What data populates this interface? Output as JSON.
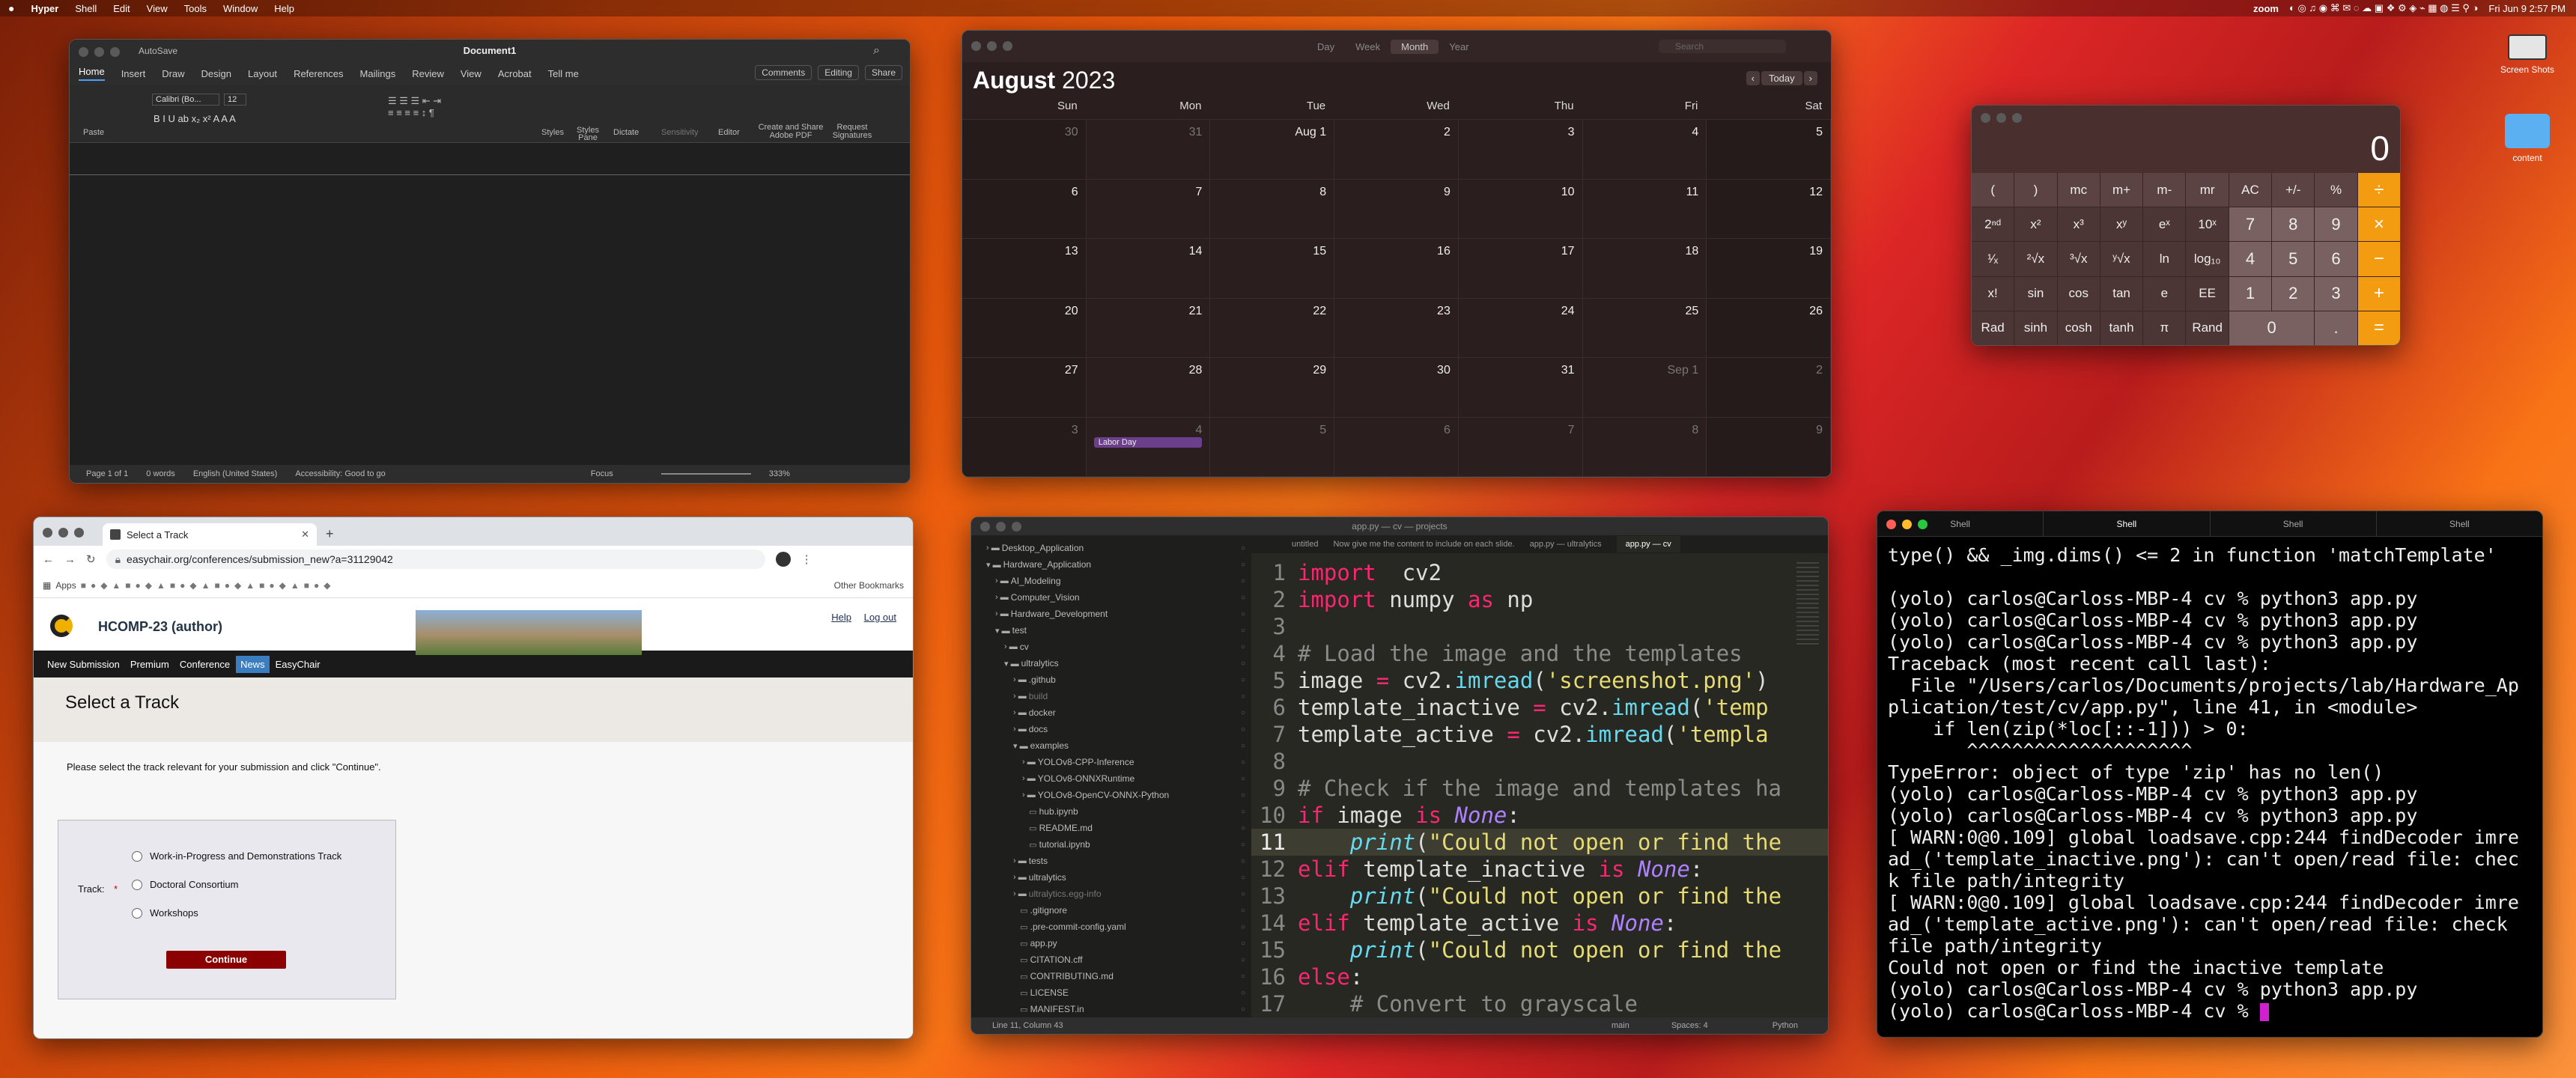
{
  "menubar": {
    "app_name": "Hyper",
    "items": [
      "Shell",
      "Edit",
      "View",
      "Tools",
      "Window",
      "Help"
    ],
    "right_app": "zoom",
    "clock": "Fri Jun 9  2:57 PM"
  },
  "desktop_icons": [
    {
      "label": "Screen Shots"
    },
    {
      "label": "content"
    }
  ],
  "word": {
    "title": "Document1",
    "autosave": "AutoSave",
    "tabs": [
      "Home",
      "Insert",
      "Draw",
      "Design",
      "Layout",
      "References",
      "Mailings",
      "Review",
      "View",
      "Acrobat",
      "Tell me"
    ],
    "comments_label": "Comments",
    "editing_label": "Editing",
    "share_label": "Share",
    "font_name": "Calibri (Bo...",
    "font_size": "12",
    "ribbon_groups": [
      "Paste",
      "Styles",
      "Styles Pane",
      "Dictate",
      "Sensitivity",
      "Editor",
      "Create and Share Adobe PDF",
      "Request Signatures"
    ],
    "status": {
      "page": "Page 1 of 1",
      "words": "0 words",
      "language": "English (United States)",
      "accessibility": "Accessibility: Good to go",
      "focus": "Focus",
      "zoom": "333%"
    }
  },
  "calendar": {
    "views": [
      "Day",
      "Week",
      "Month",
      "Year"
    ],
    "active_view": "Month",
    "search_placeholder": "Search",
    "month": "August",
    "year": "2023",
    "today_label": "Today",
    "weekdays": [
      "Sun",
      "Mon",
      "Tue",
      "Wed",
      "Thu",
      "Fri",
      "Sat"
    ],
    "weeks": [
      [
        {
          "d": "30",
          "dim": true
        },
        {
          "d": "31",
          "dim": true
        },
        {
          "d": "Aug 1"
        },
        {
          "d": "2"
        },
        {
          "d": "3"
        },
        {
          "d": "4"
        },
        {
          "d": "5"
        }
      ],
      [
        {
          "d": "6"
        },
        {
          "d": "7"
        },
        {
          "d": "8"
        },
        {
          "d": "9"
        },
        {
          "d": "10"
        },
        {
          "d": "11"
        },
        {
          "d": "12"
        }
      ],
      [
        {
          "d": "13"
        },
        {
          "d": "14"
        },
        {
          "d": "15"
        },
        {
          "d": "16"
        },
        {
          "d": "17"
        },
        {
          "d": "18"
        },
        {
          "d": "19"
        }
      ],
      [
        {
          "d": "20"
        },
        {
          "d": "21"
        },
        {
          "d": "22"
        },
        {
          "d": "23"
        },
        {
          "d": "24"
        },
        {
          "d": "25"
        },
        {
          "d": "26"
        }
      ],
      [
        {
          "d": "27"
        },
        {
          "d": "28"
        },
        {
          "d": "29"
        },
        {
          "d": "30"
        },
        {
          "d": "31"
        },
        {
          "d": "Sep 1",
          "dim": true
        },
        {
          "d": "2",
          "dim": true
        }
      ],
      [
        {
          "d": "3",
          "dim": true
        },
        {
          "d": "4",
          "dim": true
        },
        {
          "d": "5",
          "dim": true
        },
        {
          "d": "6",
          "dim": true
        },
        {
          "d": "7",
          "dim": true
        },
        {
          "d": "8",
          "dim": true
        },
        {
          "d": "9",
          "dim": true
        }
      ]
    ],
    "event": "Labor Day"
  },
  "calculator": {
    "display": "0",
    "keys": [
      [
        "(",
        ")",
        "mc",
        "m+",
        "m-",
        "mr",
        "AC",
        "+/-",
        "%",
        "÷"
      ],
      [
        "2ⁿᵈ",
        "x²",
        "x³",
        "xʸ",
        "eˣ",
        "10ˣ",
        "7",
        "8",
        "9",
        "×"
      ],
      [
        "¹⁄ₓ",
        "²√x",
        "³√x",
        "ʸ√x",
        "ln",
        "log₁₀",
        "4",
        "5",
        "6",
        "−"
      ],
      [
        "x!",
        "sin",
        "cos",
        "tan",
        "e",
        "EE",
        "1",
        "2",
        "3",
        "+"
      ],
      [
        "Rad",
        "sinh",
        "cosh",
        "tanh",
        "π",
        "Rand",
        "0",
        "",
        ".",
        "="
      ]
    ]
  },
  "browser": {
    "tab_title": "Select a Track",
    "url": "easychair.org/conferences/submission_new?a=31129042",
    "bookmarks_apps": "Apps",
    "other_bookmarks": "Other Bookmarks",
    "site_title": "HCOMP-23 (author)",
    "help_link": "Help",
    "logout_link": "Log out",
    "nav": [
      "New Submission",
      "Premium",
      "Conference",
      "News",
      "EasyChair"
    ],
    "page_heading": "Select a Track",
    "instruction": "Please select the track relevant for your submission and click \"Continue\".",
    "track_label": "Track:",
    "tracks": [
      "Work-in-Progress and Demonstrations Track",
      "Doctoral Consortium",
      "Workshops"
    ],
    "continue_label": "Continue"
  },
  "editor": {
    "title": "app.py — cv — projects",
    "tabs": [
      "untitled",
      "Now give me the content to include on each slide.",
      "app.py — ultralytics",
      "app.py — cv"
    ],
    "tree": [
      {
        "name": "Desktop_Application",
        "depth": 1,
        "type": "folder"
      },
      {
        "name": "Hardware_Application",
        "depth": 1,
        "type": "folder-open"
      },
      {
        "name": "AI_Modeling",
        "depth": 2,
        "type": "folder"
      },
      {
        "name": "Computer_Vision",
        "depth": 2,
        "type": "folder"
      },
      {
        "name": "Hardware_Development",
        "depth": 2,
        "type": "folder"
      },
      {
        "name": "test",
        "depth": 2,
        "type": "folder-open"
      },
      {
        "name": "cv",
        "depth": 3,
        "type": "folder"
      },
      {
        "name": "ultralytics",
        "depth": 3,
        "type": "folder-open"
      },
      {
        "name": ".github",
        "depth": 4,
        "type": "folder"
      },
      {
        "name": "build",
        "depth": 4,
        "type": "folder",
        "dim": true
      },
      {
        "name": "docker",
        "depth": 4,
        "type": "folder"
      },
      {
        "name": "docs",
        "depth": 4,
        "type": "folder"
      },
      {
        "name": "examples",
        "depth": 4,
        "type": "folder-open"
      },
      {
        "name": "YOLOv8-CPP-Inference",
        "depth": 5,
        "type": "folder"
      },
      {
        "name": "YOLOv8-ONNXRuntime",
        "depth": 5,
        "type": "folder"
      },
      {
        "name": "YOLOv8-OpenCV-ONNX-Python",
        "depth": 5,
        "type": "folder"
      },
      {
        "name": "hub.ipynb",
        "depth": 5,
        "type": "file"
      },
      {
        "name": "README.md",
        "depth": 5,
        "type": "file"
      },
      {
        "name": "tutorial.ipynb",
        "depth": 5,
        "type": "file"
      },
      {
        "name": "tests",
        "depth": 4,
        "type": "folder"
      },
      {
        "name": "ultralytics",
        "depth": 4,
        "type": "folder"
      },
      {
        "name": "ultralytics.egg-info",
        "depth": 4,
        "type": "folder",
        "dim": true
      },
      {
        "name": ".gitignore",
        "depth": 4,
        "type": "file"
      },
      {
        "name": ".pre-commit-config.yaml",
        "depth": 4,
        "type": "file"
      },
      {
        "name": "app.py",
        "depth": 4,
        "type": "file"
      },
      {
        "name": "CITATION.cff",
        "depth": 4,
        "type": "file"
      },
      {
        "name": "CONTRIBUTING.md",
        "depth": 4,
        "type": "file"
      },
      {
        "name": "LICENSE",
        "depth": 4,
        "type": "file"
      },
      {
        "name": "MANIFEST.in",
        "depth": 4,
        "type": "file"
      }
    ],
    "code": [
      [
        [
          "kw",
          "import"
        ],
        [
          "",
          "  cv2"
        ]
      ],
      [
        [
          "kw",
          "import"
        ],
        [
          "",
          " numpy "
        ],
        [
          "kw",
          "as"
        ],
        [
          "",
          " np"
        ]
      ],
      [],
      [
        [
          "cm",
          "# Load the image and the templates"
        ]
      ],
      [
        [
          "",
          "image "
        ],
        [
          "kw",
          "="
        ],
        [
          "",
          " cv2."
        ],
        [
          "fn",
          "imread"
        ],
        [
          "",
          "("
        ],
        [
          "st",
          "'screenshot.png'"
        ],
        [
          "",
          ")"
        ]
      ],
      [
        [
          "",
          "template_inactive "
        ],
        [
          "kw",
          "="
        ],
        [
          "",
          " cv2."
        ],
        [
          "fn",
          "imread"
        ],
        [
          "",
          "("
        ],
        [
          "st",
          "'temp"
        ]
      ],
      [
        [
          "",
          "template_active "
        ],
        [
          "kw",
          "="
        ],
        [
          "",
          " cv2."
        ],
        [
          "fn",
          "imread"
        ],
        [
          "",
          "("
        ],
        [
          "st",
          "'templa"
        ]
      ],
      [],
      [
        [
          "cm",
          "# Check if the image and templates ha"
        ]
      ],
      [
        [
          "kw",
          "if"
        ],
        [
          "",
          " image "
        ],
        [
          "kw",
          "is"
        ],
        [
          "",
          " "
        ],
        [
          "nn",
          "None"
        ],
        [
          "",
          ":"
        ]
      ],
      [
        [
          "",
          "    "
        ],
        [
          "pr",
          "print"
        ],
        [
          "",
          "("
        ],
        [
          "st",
          "\"Could not open or find the"
        ]
      ],
      [
        [
          "kw",
          "elif"
        ],
        [
          "",
          " template_inactive "
        ],
        [
          "kw",
          "is"
        ],
        [
          "",
          " "
        ],
        [
          "nn",
          "None"
        ],
        [
          "",
          ":"
        ]
      ],
      [
        [
          "",
          "    "
        ],
        [
          "pr",
          "print"
        ],
        [
          "",
          "("
        ],
        [
          "st",
          "\"Could not open or find the"
        ]
      ],
      [
        [
          "kw",
          "elif"
        ],
        [
          "",
          " template_active "
        ],
        [
          "kw",
          "is"
        ],
        [
          "",
          " "
        ],
        [
          "nn",
          "None"
        ],
        [
          "",
          ":"
        ]
      ],
      [
        [
          "",
          "    "
        ],
        [
          "pr",
          "print"
        ],
        [
          "",
          "("
        ],
        [
          "st",
          "\"Could not open or find the"
        ]
      ],
      [
        [
          "kw",
          "else"
        ],
        [
          "",
          ":"
        ]
      ],
      [
        [
          "",
          "    "
        ],
        [
          "cm",
          "# Convert to grayscale"
        ]
      ]
    ],
    "status_position": "Line 11, Column 43",
    "status_branch": "main",
    "status_spaces": "Spaces: 4",
    "status_lang": "Python"
  },
  "terminal": {
    "tabs": [
      "Shell",
      "Shell",
      "Shell",
      "Shell"
    ],
    "lines": [
      "type() && _img.dims() <= 2 in function 'matchTemplate'",
      "",
      "(yolo) carlos@Carloss-MBP-4 cv % python3 app.py",
      "(yolo) carlos@Carloss-MBP-4 cv % python3 app.py",
      "(yolo) carlos@Carloss-MBP-4 cv % python3 app.py",
      "Traceback (most recent call last):",
      "  File \"/Users/carlos/Documents/projects/lab/Hardware_Ap",
      "plication/test/cv/app.py\", line 41, in <module>",
      "    if len(zip(*loc[::-1])) > 0:",
      "       ^^^^^^^^^^^^^^^^^^^^",
      "TypeError: object of type 'zip' has no len()",
      "(yolo) carlos@Carloss-MBP-4 cv % python3 app.py",
      "(yolo) carlos@Carloss-MBP-4 cv % python3 app.py",
      "[ WARN:0@0.109] global loadsave.cpp:244 findDecoder imre",
      "ad_('template_inactive.png'): can't open/read file: chec",
      "k file path/integrity",
      "[ WARN:0@0.109] global loadsave.cpp:244 findDecoder imre",
      "ad_('template_active.png'): can't open/read file: check",
      "file path/integrity",
      "Could not open or find the inactive template",
      "(yolo) carlos@Carloss-MBP-4 cv % python3 app.py",
      "(yolo) carlos@Carloss-MBP-4 cv % "
    ]
  }
}
